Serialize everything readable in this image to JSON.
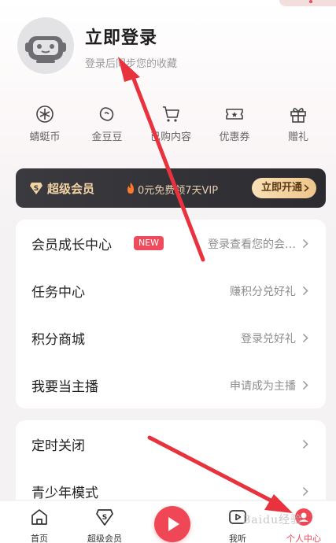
{
  "header": {
    "login_title": "立即登录",
    "login_subtitle": "登录后同步您的收藏"
  },
  "quick_links": [
    {
      "label": "蜻蜓币",
      "icon": "dragonfly-coin-icon"
    },
    {
      "label": "金豆豆",
      "icon": "gold-bean-icon"
    },
    {
      "label": "已购内容",
      "icon": "shopping-cart-icon"
    },
    {
      "label": "优惠券",
      "icon": "coupon-icon"
    },
    {
      "label": "赠礼",
      "icon": "gift-icon"
    }
  ],
  "vip_banner": {
    "title": "超级会员",
    "promo": "0元免费领7天VIP",
    "button_label": "立即开通",
    "accent_color": "#f2d3a4"
  },
  "menu_card_1": [
    {
      "label": "会员成长中心",
      "badge": "NEW",
      "value": "登录查看您的会…"
    },
    {
      "label": "任务中心",
      "value": "赚积分兑好礼"
    },
    {
      "label": "积分商城",
      "value": "登录兑好礼"
    },
    {
      "label": "我要当主播",
      "value": "申请成为主播"
    }
  ],
  "menu_card_2": [
    {
      "label": "定时关闭",
      "value": ""
    },
    {
      "label": "青少年模式",
      "value": ""
    }
  ],
  "bottom_nav": [
    {
      "label": "首页",
      "icon": "home-icon"
    },
    {
      "label": "超级会员",
      "icon": "vip-icon"
    },
    {
      "label": "我听",
      "icon": "play-list-icon"
    },
    {
      "label": "个人中心",
      "icon": "profile-icon",
      "active": true
    }
  ],
  "watermark": "Baidu经验",
  "colors": {
    "accent": "#ef4755",
    "annotation_arrow": "#e8323e"
  }
}
